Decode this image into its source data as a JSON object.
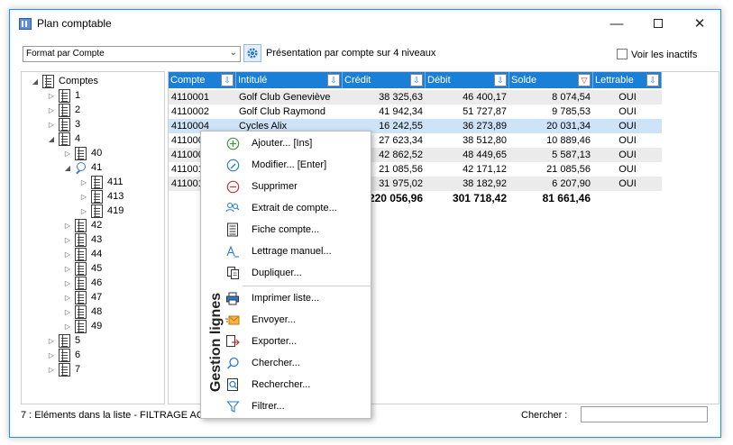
{
  "window": {
    "title": "Plan comptable"
  },
  "toolbar": {
    "format_value": "Format par Compte",
    "presentation": "Présentation par compte sur 4 niveaux",
    "show_inactive": "Voir les inactifs"
  },
  "tree": {
    "root": "Comptes",
    "nodes": [
      "1",
      "2",
      "3",
      "4",
      "40",
      "41",
      "411",
      "413",
      "419",
      "42",
      "43",
      "44",
      "45",
      "46",
      "47",
      "48",
      "49",
      "5",
      "6",
      "7"
    ]
  },
  "grid": {
    "columns": [
      "Compte",
      "Intitulé",
      "Crédit",
      "Débit",
      "Solde",
      "Lettrable"
    ],
    "rows": [
      [
        "4110001",
        "Golf Club Geneviève",
        "38 325,63",
        "46 400,17",
        "8 074,54",
        "OUI"
      ],
      [
        "4110002",
        "Golf Club Raymond",
        "41 942,34",
        "51 727,87",
        "9 785,53",
        "OUI"
      ],
      [
        "4110004",
        "Cycles Alix",
        "16 242,55",
        "36 273,89",
        "20 031,34",
        "OUI"
      ],
      [
        "411000",
        "",
        "27 623,34",
        "38 512,80",
        "10 889,46",
        "OUI"
      ],
      [
        "411000",
        "",
        "42 862,52",
        "48 449,65",
        "5 587,13",
        "OUI"
      ],
      [
        "411001",
        "",
        "21 085,56",
        "42 171,12",
        "21 085,56",
        "OUI"
      ],
      [
        "411001",
        "",
        "31 975,02",
        "38 182,92",
        "6 207,90",
        "OUI"
      ]
    ],
    "totals": [
      "220 056,96",
      "301 718,42",
      "81 661,46"
    ]
  },
  "status": {
    "text": "7 : Eléments dans la liste - FILTRAGE AC",
    "search_label": "Chercher :"
  },
  "context_menu": {
    "side_label": "Gestion lignes",
    "items": [
      "Ajouter... [Ins]",
      "Modifier... [Enter]",
      "Supprimer",
      "Extrait de compte...",
      "Fiche compte...",
      "Lettrage manuel...",
      "Dupliquer...",
      "Imprimer liste...",
      "Envoyer...",
      "Exporter...",
      "Chercher...",
      "Rechercher...",
      "Filtrer..."
    ]
  }
}
